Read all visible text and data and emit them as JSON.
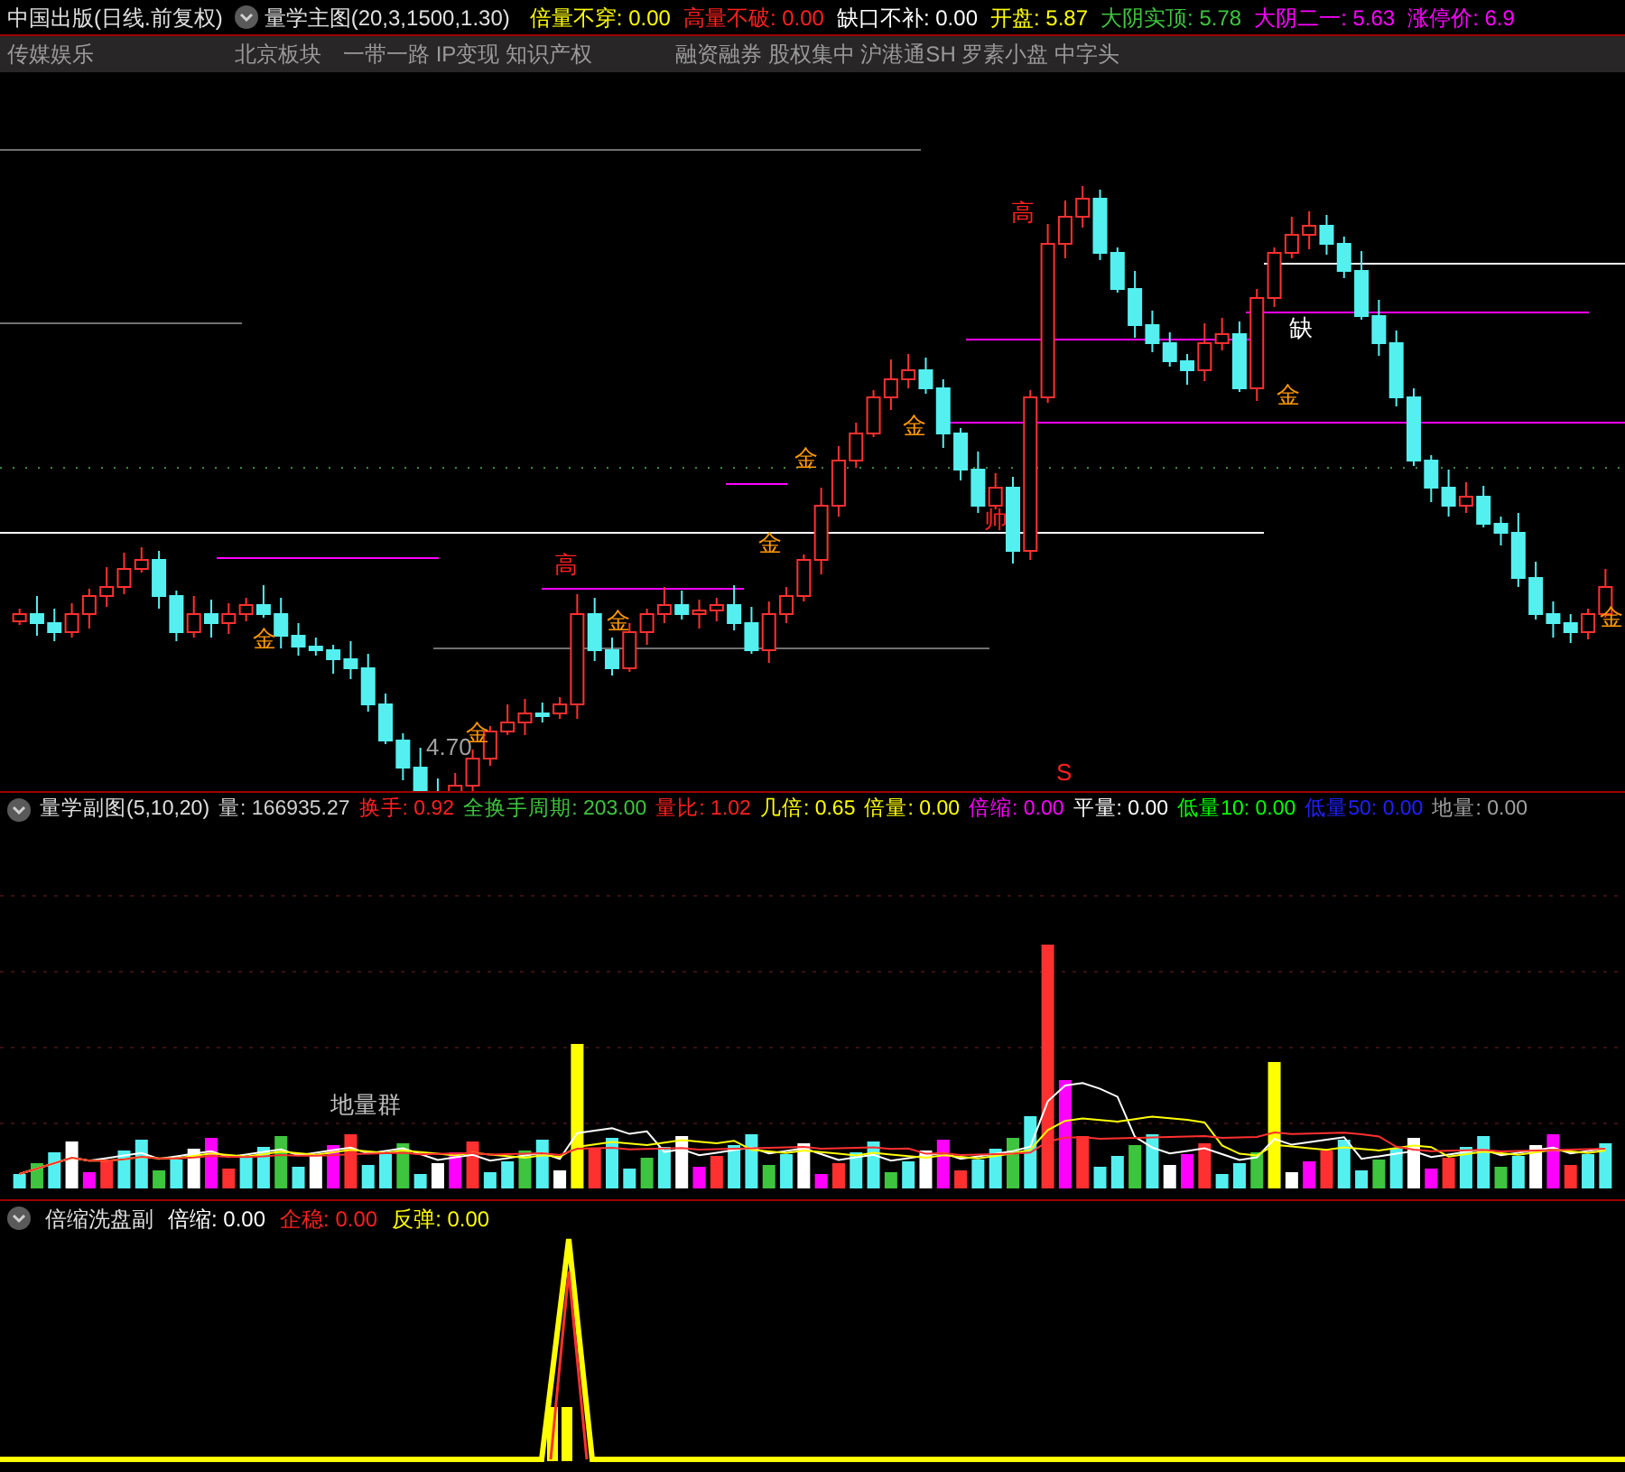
{
  "header": {
    "title": "中国出版(日线.前复权)",
    "indicator": "量学主图(20,3,1500,1.30)",
    "readouts": [
      {
        "text": "倍量不穿: 0.00",
        "color": "#ffff00"
      },
      {
        "text": "高量不破: 0.00",
        "color": "#ff2020"
      },
      {
        "text": "缺口不补: 0.00",
        "color": "#ffffff"
      },
      {
        "text": "开盘: 5.87",
        "color": "#ffff00"
      },
      {
        "text": "大阴实顶: 5.78",
        "color": "#3ec43e"
      },
      {
        "text": "大阴二一: 5.63",
        "color": "#ff00ff"
      },
      {
        "text": "涨停价: 6.9",
        "color": "#ff00ff"
      }
    ]
  },
  "tags": [
    "传媒娱乐",
    "北京板块",
    "一带一路 IP变现 知识产权",
    "融资融券 股权集中 沪港通SH 罗素小盘 中字头"
  ],
  "main_chart": {
    "marks": [
      {
        "text": "金",
        "color": "#ff9900"
      },
      {
        "text": "4.70",
        "color": "#a0a0a0"
      },
      {
        "text": "金",
        "color": "#ff9900"
      },
      {
        "text": "高",
        "color": "#ff2020"
      },
      {
        "text": "金",
        "color": "#ff9900"
      },
      {
        "text": "金",
        "color": "#ff9900"
      },
      {
        "text": "金",
        "color": "#ff9900"
      },
      {
        "text": "金",
        "color": "#ff9900"
      },
      {
        "text": "高",
        "color": "#ff2020"
      },
      {
        "text": "帅",
        "color": "#ff2020"
      },
      {
        "text": "缺",
        "color": "#ffffff"
      },
      {
        "text": "金",
        "color": "#ff9900"
      },
      {
        "text": "金",
        "color": "#ff9900"
      },
      {
        "text": "S",
        "color": "#ff2020"
      }
    ]
  },
  "volume_panel": {
    "indicator": "量学副图(5,10,20)",
    "readouts": [
      {
        "text": "量: 166935.27",
        "color": "#d0d0d0"
      },
      {
        "text": "换手: 0.92",
        "color": "#ff2020"
      },
      {
        "text": "全换手周期: 203.00",
        "color": "#3ec43e"
      },
      {
        "text": "量比: 1.02",
        "color": "#ff2020"
      },
      {
        "text": "几倍: 0.65",
        "color": "#ffff00"
      },
      {
        "text": "倍量: 0.00",
        "color": "#ffff00"
      },
      {
        "text": "倍缩: 0.00",
        "color": "#ff00ff"
      },
      {
        "text": "平量: 0.00",
        "color": "#ffffff"
      },
      {
        "text": "低量10: 0.00",
        "color": "#00ff00"
      },
      {
        "text": "低量50: 0.00",
        "color": "#2020ff"
      },
      {
        "text": "地量: 0.00",
        "color": "#a0a0a0"
      }
    ],
    "label": "地量群"
  },
  "bottom_panel": {
    "indicator": "倍缩洗盘副",
    "readouts": [
      {
        "text": "倍缩: 0.00",
        "color": "#ffffff"
      },
      {
        "text": "企稳: 0.00",
        "color": "#ff2020"
      },
      {
        "text": "反弹: 0.00",
        "color": "#ffff00"
      }
    ]
  }
}
